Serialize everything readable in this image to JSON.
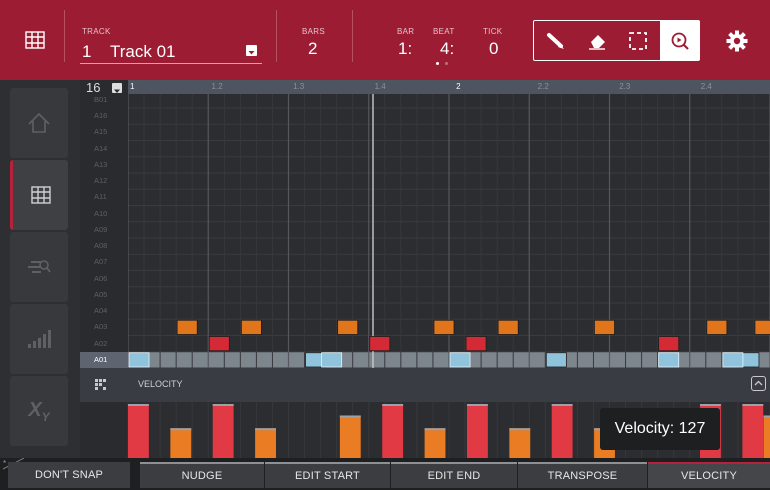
{
  "header": {
    "track_label": "TRACK",
    "track_number": "1",
    "track_name": "Track 01",
    "bars_label": "BARS",
    "bars_value": "2",
    "bar_label": "BAR",
    "bar_value": "1:",
    "beat_label": "BEAT",
    "beat_value": "4:",
    "tick_label": "TICK",
    "tick_value": "0"
  },
  "tools": [
    "pencil",
    "eraser",
    "select",
    "zoom"
  ],
  "selected_tool": "zoom",
  "sidebar": [
    "home",
    "grid",
    "list-edit",
    "velocity-bars",
    "xy"
  ],
  "active_sidebar": "grid",
  "pad_bank_label": "16",
  "pad_rows": [
    "B01",
    "A16",
    "A15",
    "A14",
    "A13",
    "A12",
    "A11",
    "A10",
    "A09",
    "A08",
    "A07",
    "A06",
    "A05",
    "A04",
    "A03",
    "A02",
    "A01"
  ],
  "ruler_ticks": [
    "1",
    "1.2",
    "1.3",
    "1.4",
    "2",
    "2.2",
    "2.3",
    "2.4"
  ],
  "notes": [
    {
      "pad": "A03",
      "step": 3
    },
    {
      "pad": "A02",
      "step": 5
    },
    {
      "pad": "A03",
      "step": 7
    },
    {
      "pad": "A01",
      "step": 11
    },
    {
      "pad": "A03",
      "step": 13
    },
    {
      "pad": "A02",
      "step": 15
    },
    {
      "pad": "A03",
      "step": 19
    },
    {
      "pad": "A02",
      "step": 21
    },
    {
      "pad": "A03",
      "step": 23
    },
    {
      "pad": "A01",
      "step": 26
    },
    {
      "pad": "A03",
      "step": 29
    },
    {
      "pad": "A02",
      "step": 33
    },
    {
      "pad": "A03",
      "step": 36
    },
    {
      "pad": "A01",
      "step": 38
    },
    {
      "pad": "A03",
      "step": 39
    },
    {
      "pad": "A04",
      "step": 41
    }
  ],
  "velocity": {
    "label": "VELOCITY",
    "bars": [
      {
        "step": 1,
        "value": 127,
        "color": "red"
      },
      {
        "step": 3,
        "value": 70,
        "color": "orange"
      },
      {
        "step": 5,
        "value": 127,
        "color": "red"
      },
      {
        "step": 7,
        "value": 70,
        "color": "orange"
      },
      {
        "step": 11,
        "value": 100,
        "color": "orange"
      },
      {
        "step": 13,
        "value": 127,
        "color": "red"
      },
      {
        "step": 15,
        "value": 70,
        "color": "orange"
      },
      {
        "step": 17,
        "value": 127,
        "color": "red"
      },
      {
        "step": 19,
        "value": 70,
        "color": "orange"
      },
      {
        "step": 21,
        "value": 127,
        "color": "red"
      },
      {
        "step": 23,
        "value": 70,
        "color": "orange"
      },
      {
        "step": 28,
        "value": 127,
        "color": "red"
      },
      {
        "step": 30,
        "value": 127,
        "color": "red"
      },
      {
        "step": 31,
        "value": 100,
        "color": "orange"
      }
    ]
  },
  "tooltip": "Velocity: 127",
  "bottom": {
    "dont_snap": "DON'T SNAP",
    "nudge": "NUDGE",
    "edit_start": "EDIT START",
    "edit_end": "EDIT END",
    "transpose": "TRANSPOSE",
    "velocity": "VELOCITY"
  },
  "colors": {
    "header": "#9b1c33",
    "note_red": "#d42a36",
    "note_orange": "#e0751c",
    "note_selected": "#8fc4dc",
    "accent": "#b8213b"
  }
}
